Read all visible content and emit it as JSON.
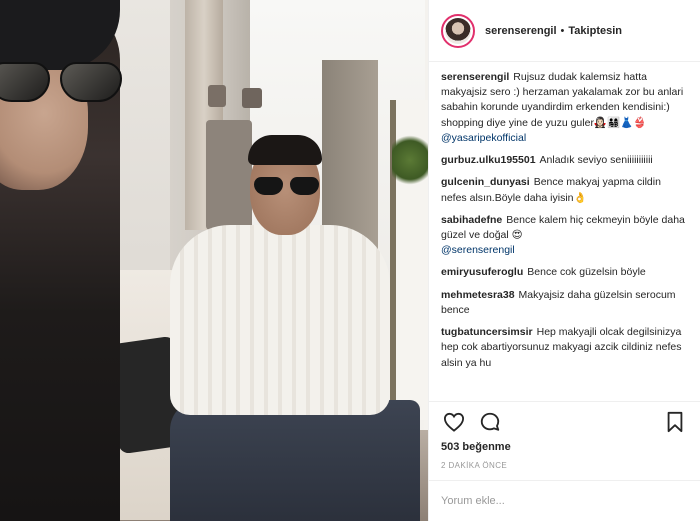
{
  "header": {
    "username": "serenserengil",
    "separator": "•",
    "follow_status": "Takiptesin"
  },
  "comments": [
    {
      "user": "serenserengil",
      "text": "Rujsuz dudak kalemsiz hatta makyajsiz sero :) herzaman yakalamak zor bu anlari sabahin korunde uyandirdim erkenden kendisini:) shopping diye yine de yuzu guler🧛🏻‍♀️👨‍👩‍👧‍👦👗👙",
      "mention": "@yasaripekofficial"
    },
    {
      "user": "gurbuz.ulku195501",
      "text": "Anladık seviyo seniiiiiiiiiii",
      "mention": ""
    },
    {
      "user": "gulcenin_dunyasi",
      "text": "Bence makyaj yapma cildin nefes alsın.Böyle daha iyisin👌",
      "mention": ""
    },
    {
      "user": "sabihadefne",
      "text": "Bence kalem hiç cekmeyin böyle daha güzel ve doğal 😍",
      "mention": "@serenserengil"
    },
    {
      "user": "emiryusuferoglu",
      "text": "Bence cok güzelsin böyle",
      "mention": ""
    },
    {
      "user": "mehmetesra38",
      "text": "Makyajsiz daha güzelsin serocum bence",
      "mention": ""
    },
    {
      "user": "tugbatuncersimsir",
      "text": "Hep makyajli olcak degilsinizya hep cok abartiyorsunuz makyagi azcik cildiniz nefes alsin ya hu",
      "mention": ""
    }
  ],
  "likes": "503 beğenme",
  "time": "2 DAKİKA ÖNCE",
  "composer": {
    "placeholder": "Yorum ekle..."
  },
  "icons": {
    "like": "heart-icon",
    "comment": "comment-icon",
    "save": "bookmark-icon"
  },
  "colors": {
    "story_ring": "#e1306c",
    "mention": "#003569"
  }
}
